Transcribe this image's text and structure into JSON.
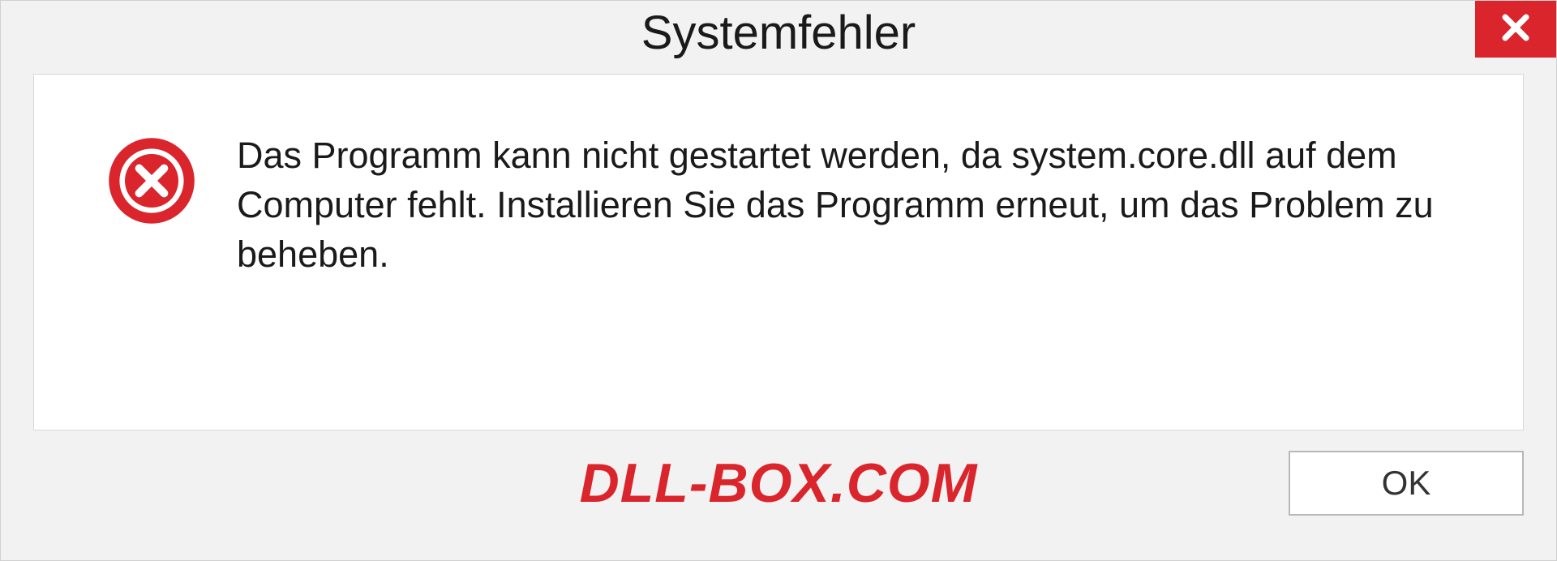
{
  "dialog": {
    "title": "Systemfehler",
    "message": "Das Programm kann nicht gestartet werden, da system.core.dll auf dem Computer fehlt. Installieren Sie das Programm erneut, um das Problem zu beheben.",
    "ok_label": "OK"
  },
  "watermark": "DLL-BOX.COM"
}
